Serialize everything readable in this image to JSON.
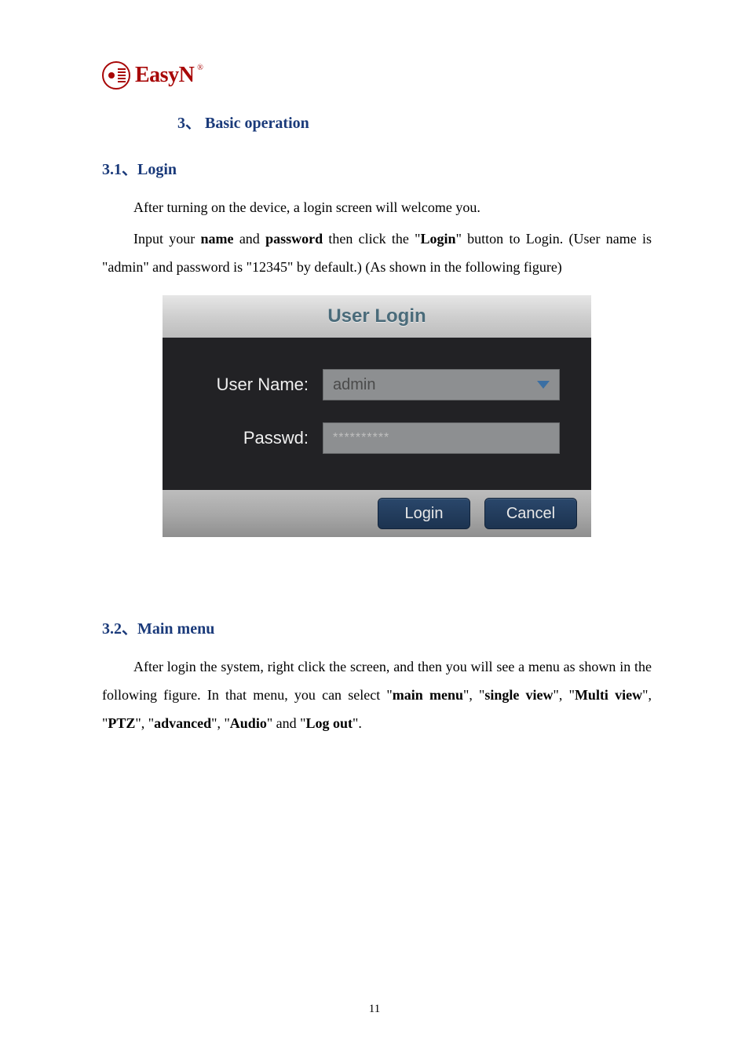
{
  "logo": {
    "text": "EasyN",
    "reg": "®"
  },
  "section3": {
    "title": "3、 Basic operation",
    "sub1_title": "3.1、Login",
    "p1": "After turning on the device, a login screen will welcome you.",
    "p2_a": "Input your ",
    "p2_name": "name",
    "p2_b": " and ",
    "p2_pwd": "password",
    "p2_c": " then click the \"",
    "p2_login": "Login",
    "p2_d": "\" button to Login. (User name is \"admin\" and password is \"12345\" by default.)   (As shown in the following figure)",
    "sub2_title": "3.2、Main menu",
    "p3_a": "After login the system, right click the screen, and then you will see a menu as shown in the following figure. In that menu, you can select \"",
    "p3_mainmenu": "main menu",
    "p3_b": "\", \"",
    "p3_single": "single view",
    "p3_c": "\", \"",
    "p3_multi": "Multi view",
    "p3_d": "\", \"",
    "p3_ptz": "PTZ",
    "p3_e": "\", \"",
    "p3_adv": "advanced",
    "p3_f": "\", \"",
    "p3_audio": "Audio",
    "p3_g": "\" and \"",
    "p3_logout": "Log out",
    "p3_h": "\"."
  },
  "dialog": {
    "title": "User Login",
    "username_label": "User Name:",
    "username_value": "admin",
    "passwd_label": "Passwd:",
    "passwd_value": "**********",
    "login_btn": "Login",
    "cancel_btn": "Cancel"
  },
  "page_number": "11"
}
